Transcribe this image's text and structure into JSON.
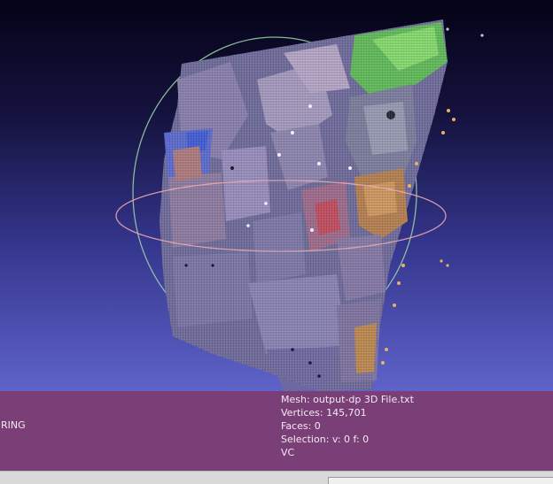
{
  "viewport": {
    "background_top": "#050316",
    "background_bottom": "#5f63c9"
  },
  "overlay": {
    "mode_label": "RING",
    "mesh_line": "Mesh: output-dp 3D File.txt",
    "vertices_line": "Vertices: 145,701",
    "faces_line": "Faces: 0",
    "selection_line": "Selection: v: 0 f: 0",
    "color_mode_line": "VC"
  },
  "colors": {
    "info_bar": "#7b3f78",
    "trackball_vertical": "#9fd6a8",
    "trackball_horizontal": "#e7a8b0",
    "point_cloud_accent": "#7fd86b"
  },
  "icons": {
    "trackball": "trackball-ring-icon"
  }
}
